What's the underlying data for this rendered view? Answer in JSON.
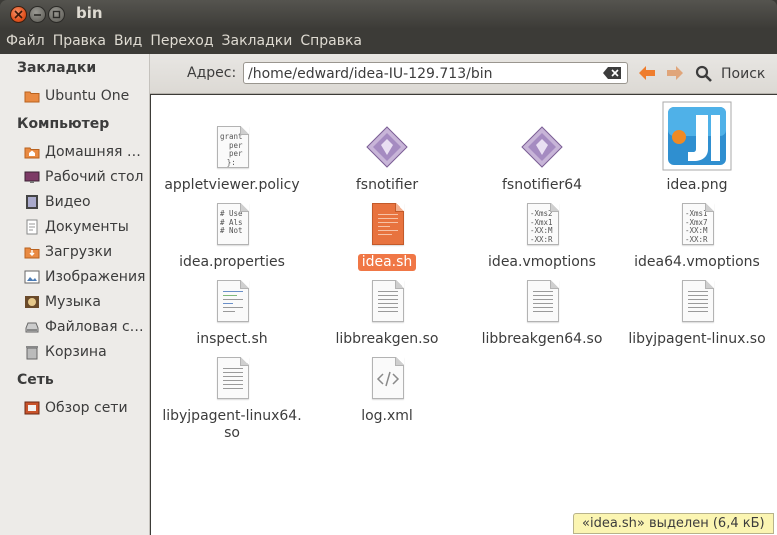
{
  "window": {
    "title": "bin"
  },
  "menu": [
    "Файл",
    "Правка",
    "Вид",
    "Переход",
    "Закладки",
    "Справка"
  ],
  "sidebar": {
    "sections": [
      {
        "title": "Закладки",
        "items": [
          {
            "label": "Ubuntu One",
            "icon": "folder-icon"
          }
        ]
      },
      {
        "title": "Компьютер",
        "items": [
          {
            "label": "Домашняя …",
            "icon": "home-folder-icon"
          },
          {
            "label": "Рабочий стол",
            "icon": "desktop-icon"
          },
          {
            "label": "Видео",
            "icon": "video-icon"
          },
          {
            "label": "Документы",
            "icon": "documents-icon"
          },
          {
            "label": "Загрузки",
            "icon": "downloads-icon"
          },
          {
            "label": "Изображения",
            "icon": "pictures-icon"
          },
          {
            "label": "Музыка",
            "icon": "music-icon"
          },
          {
            "label": "Файловая с…",
            "icon": "drive-icon"
          },
          {
            "label": "Корзина",
            "icon": "trash-icon"
          }
        ]
      },
      {
        "title": "Сеть",
        "items": [
          {
            "label": "Обзор сети",
            "icon": "network-icon"
          }
        ]
      }
    ]
  },
  "toolbar": {
    "address_label": "Адрес:",
    "address_value": "/home/edward/idea-IU-129.713/bin",
    "search_label": "Поиск"
  },
  "files": [
    {
      "name": "appletviewer.policy",
      "icon": "text-file-icon",
      "preview": "grant\n  per\n  per\n}:"
    },
    {
      "name": "fsnotifier",
      "icon": "executable-icon"
    },
    {
      "name": "fsnotifier64",
      "icon": "executable-icon"
    },
    {
      "name": "idea.png",
      "icon": "image-file-icon"
    },
    {
      "name": "idea.properties",
      "icon": "text-file-icon",
      "preview": "# Use\n# Als\n# Not"
    },
    {
      "name": "idea.sh",
      "icon": "script-file-icon",
      "selected": true
    },
    {
      "name": "idea.vmoptions",
      "icon": "text-file-icon",
      "preview": "-Xms2\n-Xmx1\n-XX:M\n-XX:R"
    },
    {
      "name": "idea64.vmoptions",
      "icon": "text-file-icon",
      "preview": "-Xms1\n-Xmx7\n-XX:M\n-XX:R"
    },
    {
      "name": "inspect.sh",
      "icon": "script-file-icon"
    },
    {
      "name": "libbreakgen.so",
      "icon": "library-file-icon"
    },
    {
      "name": "libbreakgen64.so",
      "icon": "library-file-icon"
    },
    {
      "name": "libyjpagent-linux.so",
      "icon": "library-file-icon"
    },
    {
      "name": "libyjpagent-linux64.\nso",
      "icon": "library-file-icon"
    },
    {
      "name": "log.xml",
      "icon": "xml-file-icon"
    }
  ],
  "status": {
    "text": "«idea.sh» выделен (6,4 кБ)"
  },
  "colors": {
    "accent": "#f07746",
    "title_bg": "#3c3b37",
    "sidebar_bg": "#edebe8"
  }
}
